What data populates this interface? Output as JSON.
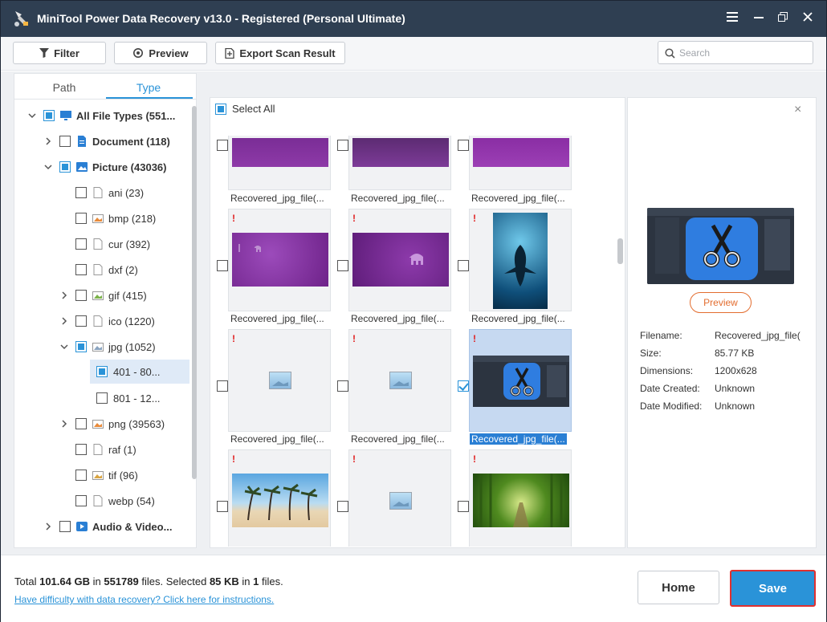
{
  "window": {
    "title": "MiniTool Power Data Recovery v13.0 - Registered (Personal Ultimate)"
  },
  "toolbar": {
    "filter_label": "Filter",
    "preview_label": "Preview",
    "export_label": "Export Scan Result",
    "search_placeholder": "Search"
  },
  "left_panel": {
    "tabs": [
      "Path",
      "Type"
    ],
    "active_tab": "Type",
    "tree": [
      {
        "label": "All File Types (551...",
        "level": 0,
        "expanded": true,
        "state": "partial",
        "bold": true,
        "icon": "monitor-icon"
      },
      {
        "label": "Document (118)",
        "level": 1,
        "expanded": false,
        "state": "unchecked",
        "bold": true,
        "icon": "document-icon"
      },
      {
        "label": "Picture (43036)",
        "level": 1,
        "expanded": true,
        "state": "partial",
        "bold": true,
        "icon": "picture-icon"
      },
      {
        "label": "ani (23)",
        "level": 2,
        "state": "unchecked",
        "icon": "file-icon"
      },
      {
        "label": "bmp (218)",
        "level": 2,
        "state": "unchecked",
        "icon": "image-file-icon"
      },
      {
        "label": "cur (392)",
        "level": 2,
        "state": "unchecked",
        "icon": "file-icon"
      },
      {
        "label": "dxf (2)",
        "level": 2,
        "state": "unchecked",
        "icon": "file-icon"
      },
      {
        "label": "gif (415)",
        "level": 2,
        "expandable": true,
        "state": "unchecked",
        "icon": "gif-file-icon"
      },
      {
        "label": "ico (1220)",
        "level": 2,
        "expandable": true,
        "state": "unchecked",
        "icon": "file-icon"
      },
      {
        "label": "jpg (1052)",
        "level": 2,
        "expanded": true,
        "state": "partial",
        "icon": "jpg-file-icon"
      },
      {
        "label": "401 - 80...",
        "level": 3,
        "state": "partial",
        "selected": true
      },
      {
        "label": "801 - 12...",
        "level": 3,
        "state": "unchecked"
      },
      {
        "label": "png (39563)",
        "level": 2,
        "expandable": true,
        "state": "unchecked",
        "icon": "png-file-icon"
      },
      {
        "label": "raf (1)",
        "level": 2,
        "state": "unchecked",
        "icon": "file-icon"
      },
      {
        "label": "tif (96)",
        "level": 2,
        "state": "unchecked",
        "icon": "tif-file-icon"
      },
      {
        "label": "webp (54)",
        "level": 2,
        "state": "unchecked",
        "icon": "file-icon"
      },
      {
        "label": "Audio & Video...",
        "level": 1,
        "expanded": false,
        "state": "unchecked",
        "bold": true,
        "icon": "audio-video-icon"
      }
    ]
  },
  "center_panel": {
    "select_all_label": "Select All",
    "files": [
      {
        "name": "Recovered_jpg_file(...",
        "thumb": "purple-top",
        "warn": false,
        "checked": false
      },
      {
        "name": "Recovered_jpg_file(...",
        "thumb": "purple-top",
        "warn": false,
        "checked": false
      },
      {
        "name": "Recovered_jpg_file(...",
        "thumb": "purple-top",
        "warn": false,
        "checked": false
      },
      {
        "name": "Recovered_jpg_file(...",
        "thumb": "purple-elephant",
        "warn": true,
        "checked": false
      },
      {
        "name": "Recovered_jpg_file(...",
        "thumb": "purple-elephant-right",
        "warn": true,
        "checked": false
      },
      {
        "name": "Recovered_jpg_file(...",
        "thumb": "whale-shark",
        "warn": true,
        "checked": false
      },
      {
        "name": "Recovered_jpg_file(...",
        "thumb": "placeholder",
        "warn": true,
        "checked": false
      },
      {
        "name": "Recovered_jpg_file(...",
        "thumb": "placeholder",
        "warn": true,
        "checked": false
      },
      {
        "name": "Recovered_jpg_file(...",
        "thumb": "scissors-app",
        "warn": true,
        "checked": true,
        "selected": true
      },
      {
        "name": "",
        "thumb": "palm-beach",
        "warn": true,
        "checked": false
      },
      {
        "name": "",
        "thumb": "placeholder",
        "warn": true,
        "checked": false
      },
      {
        "name": "",
        "thumb": "bamboo-forest",
        "warn": true,
        "checked": false
      }
    ]
  },
  "preview_panel": {
    "preview_button": "Preview",
    "fields": [
      {
        "key": "Filename:",
        "value": "Recovered_jpg_file("
      },
      {
        "key": "Size:",
        "value": "85.77 KB"
      },
      {
        "key": "Dimensions:",
        "value": "1200x628"
      },
      {
        "key": "Date Created:",
        "value": "Unknown"
      },
      {
        "key": "Date Modified:",
        "value": "Unknown"
      }
    ]
  },
  "footer": {
    "total_prefix": "Total",
    "total_size": "101.64 GB",
    "in_word": "in",
    "total_files": "551789",
    "files_word": "files.",
    "selected_word": "Selected",
    "selected_size": "85 KB",
    "selected_files": "1",
    "help_link": "Have difficulty with data recovery? Click here for instructions.",
    "home_label": "Home",
    "save_label": "Save"
  },
  "colors": {
    "titlebar": "#2f3f52",
    "accent": "#2a93d8",
    "save_highlight": "#e0302f",
    "preview_orange": "#e36d2f"
  }
}
